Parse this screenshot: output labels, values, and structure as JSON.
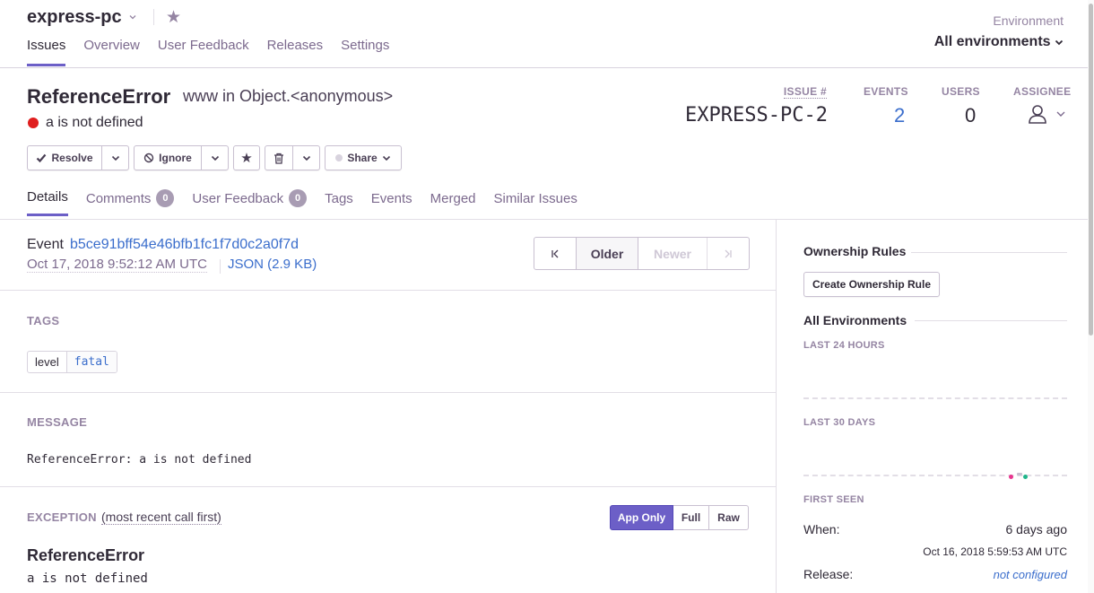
{
  "header": {
    "project": "express-pc",
    "nav": [
      "Issues",
      "Overview",
      "User Feedback",
      "Releases",
      "Settings"
    ],
    "env_label": "Environment",
    "env_value": "All environments"
  },
  "issue": {
    "type": "ReferenceError",
    "location": "www in Object.<anonymous>",
    "message": "a is not defined",
    "level_color": "#e01e1e",
    "stats": {
      "issue_label": "ISSUE #",
      "issue_value": "EXPRESS-PC-2",
      "events_label": "EVENTS",
      "events_value": "2",
      "users_label": "USERS",
      "users_value": "0",
      "assignee_label": "ASSIGNEE"
    }
  },
  "actions": {
    "resolve": "Resolve",
    "ignore": "Ignore",
    "share": "Share"
  },
  "tabs": [
    {
      "label": "Details"
    },
    {
      "label": "Comments",
      "badge": "0"
    },
    {
      "label": "User Feedback",
      "badge": "0"
    },
    {
      "label": "Tags"
    },
    {
      "label": "Events"
    },
    {
      "label": "Merged"
    },
    {
      "label": "Similar Issues"
    }
  ],
  "event": {
    "label": "Event",
    "id": "b5ce91bff54e46bfb1fc1f7d0c2a0f7d",
    "date": "Oct 17, 2018 9:52:12 AM UTC",
    "json": "JSON (2.9 KB)",
    "pager": {
      "older": "Older",
      "newer": "Newer"
    }
  },
  "tags_section": {
    "title": "TAGS",
    "tags": [
      {
        "key": "level",
        "value": "fatal"
      }
    ]
  },
  "message_section": {
    "title": "MESSAGE",
    "text": "ReferenceError: a is not defined"
  },
  "exception_section": {
    "title": "EXCEPTION",
    "hint": "(most recent call first)",
    "toggle": [
      "App Only",
      "Full",
      "Raw"
    ],
    "type": "ReferenceError",
    "value": "a is not defined"
  },
  "sidebar": {
    "ownership_title": "Ownership Rules",
    "ownership_button": "Create Ownership Rule",
    "env_title": "All Environments",
    "last24": "LAST 24 HOURS",
    "last30": "LAST 30 DAYS",
    "first_seen": "FIRST SEEN",
    "when_label": "When:",
    "when_value": "6 days ago",
    "when_date": "Oct 16, 2018 5:59:53 AM UTC",
    "release_label": "Release:",
    "release_value": "not configured"
  },
  "colors": {
    "accent": "#6c5fc7",
    "link": "#3b6ecc",
    "spark_pink": "#e8358f",
    "spark_green": "#1fb58a"
  }
}
